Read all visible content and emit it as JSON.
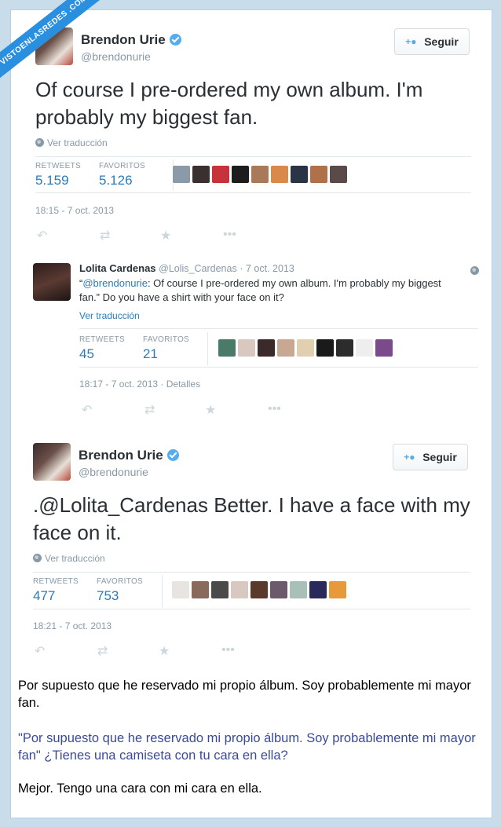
{
  "watermark": "VISTOENLASREDES .COM",
  "tweet1": {
    "name": "Brendon Urie",
    "handle": "@brendonurie",
    "follow_label": "Seguir",
    "text": "Of course I pre-ordered my own album. I'm probably my biggest fan.",
    "translate": "Ver traducción",
    "retweets_label": "RETWEETS",
    "retweets": "5.159",
    "favorites_label": "FAVORITOS",
    "favorites": "5.126",
    "timestamp": "18:15 - 7 oct. 2013"
  },
  "reply": {
    "name": "Lolita Cardenas",
    "handle": "@Lolis_Cardenas",
    "date": "· 7 oct. 2013",
    "quote_open": "“",
    "mention": "@brendonurie",
    "text": ": Of course I pre-ordered my own album. I'm probably my biggest fan.” Do you have a shirt with your face on it?",
    "translate": "Ver traducción",
    "retweets_label": "RETWEETS",
    "retweets": "45",
    "favorites_label": "FAVORITOS",
    "favorites": "21",
    "timestamp": "18:17 - 7 oct. 2013",
    "details": "Detalles"
  },
  "tweet2": {
    "name": "Brendon Urie",
    "handle": "@brendonurie",
    "follow_label": "Seguir",
    "text": ".@Lolita_Cardenas Better. I have a face with my face on it.",
    "translate": "Ver traducción",
    "retweets_label": "RETWEETS",
    "retweets": "477",
    "favorites_label": "FAVORITOS",
    "favorites": "753",
    "timestamp": "18:21 - 7 oct. 2013"
  },
  "translations": {
    "t1": "Por supuesto que he reservado mi propio álbum. Soy probablemente mi mayor fan.",
    "t2": "\"Por supuesto que he reservado mi propio álbum. Soy probablemente mi mayor fan\" ¿Tienes una camiseta con tu cara en ella?",
    "t3": "Mejor. Tengo una cara con mi cara en ella."
  }
}
